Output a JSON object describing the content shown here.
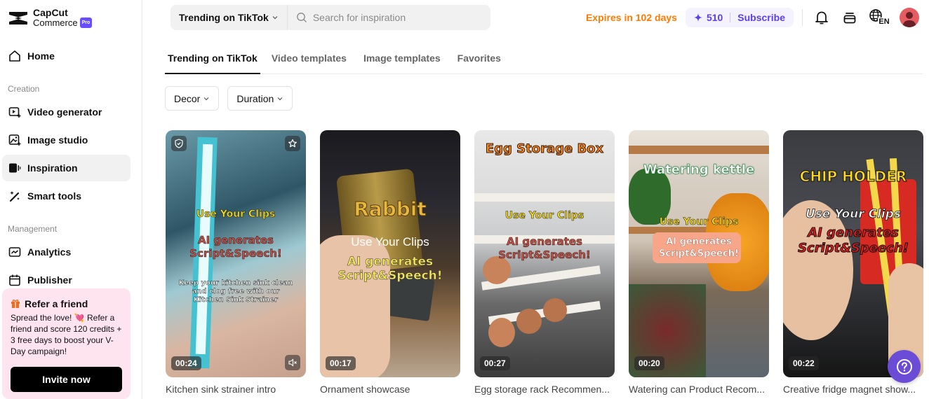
{
  "app": {
    "brand_line1": "CapCut",
    "brand_line2": "Commerce",
    "brand_badge": "Pro"
  },
  "sidebar": {
    "home": "Home",
    "sections": [
      {
        "label": "Creation"
      },
      {
        "label": "Management"
      }
    ],
    "items": [
      {
        "label": "Video generator",
        "icon": "video-generator-icon"
      },
      {
        "label": "Image studio",
        "icon": "image-studio-icon"
      },
      {
        "label": "Inspiration",
        "icon": "inspiration-icon",
        "active": true
      },
      {
        "label": "Smart tools",
        "icon": "magic-wand-icon"
      },
      {
        "label": "Analytics",
        "icon": "analytics-icon"
      },
      {
        "label": "Publisher",
        "icon": "calendar-icon"
      }
    ],
    "refer": {
      "title": "Refer a friend",
      "text": "Spread the love! 💘 Refer a friend and score 120 credits + 3 free days to boost your V-Day campaign!",
      "button": "Invite now"
    }
  },
  "header": {
    "source_select": "Trending on TikTok",
    "search_placeholder": "Search for inspiration",
    "expires": "Expires in 102 days",
    "credits": "510",
    "subscribe": "Subscribe",
    "language": "EN"
  },
  "tabs": [
    {
      "label": "Trending on TikTok",
      "active": true
    },
    {
      "label": "Video templates"
    },
    {
      "label": "Image templates"
    },
    {
      "label": "Favorites"
    }
  ],
  "filters": [
    {
      "label": "Decor"
    },
    {
      "label": "Duration"
    }
  ],
  "cards": [
    {
      "title": "Kitchen sink strainer intro",
      "duration": "00:24",
      "overlay_top": "",
      "overlay_clips": "Use Your Clips",
      "overlay_ai": "AI generates Script&Speech!",
      "overlay_caption": "Keep your kitchen sink clean and clog free with our Kitchen Sink Strainer"
    },
    {
      "title": "Ornament showcase",
      "duration": "00:17",
      "overlay_top": "Rabbit",
      "overlay_clips": "Use Your Clips",
      "overlay_ai": "AI generates Script&Speech!"
    },
    {
      "title": "Egg storage rack Recommen...",
      "duration": "00:27",
      "overlay_top": "Egg Storage Box",
      "overlay_clips": "Use Your Clips",
      "overlay_ai": "AI generates Script&Speech!"
    },
    {
      "title": "Watering can Product Recom...",
      "duration": "00:20",
      "overlay_top": "Watering kettle",
      "overlay_clips": "Use Your Clips",
      "overlay_ai": "AI generates Script&Speech!"
    },
    {
      "title": "Creative fridge magnet show...",
      "duration": "00:22",
      "overlay_top": "CHIP HOLDER",
      "overlay_clips": "Use Your Clips",
      "overlay_ai": "AI generates Script&Speech!"
    }
  ],
  "colors": {
    "accent": "#5b3fe8",
    "expires": "#ff7a00",
    "refer_bg": "#fde4ef",
    "fab": "#6a4cd6"
  }
}
